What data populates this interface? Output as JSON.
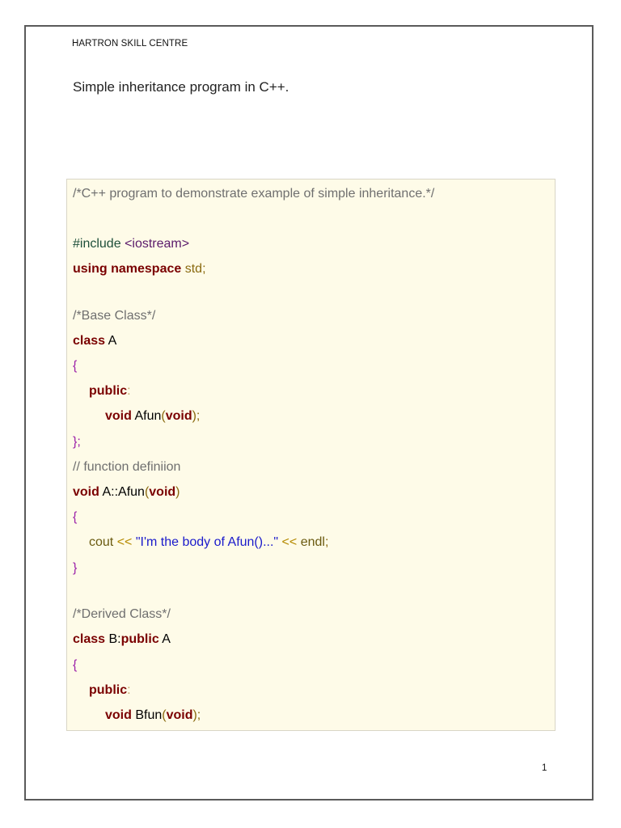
{
  "header": {
    "org": "HARTRON SKILL CENTRE"
  },
  "document": {
    "title": "Simple inheritance program in C++.",
    "page_number": "1"
  },
  "code": {
    "l1_comment": "/*C++ program to demonstrate example of simple inheritance.*/",
    "l2_directive": "#include",
    "l2_header": "<iostream>",
    "l3_kw": "using namespace",
    "l3_std": "std",
    "l3_semi": ";",
    "l4_comment": "/*Base Class*/",
    "l5_kw": "class",
    "l5_name": " A",
    "l6_brace": "{",
    "l7_kw": "public",
    "l7_colon": ":",
    "l8_kw": "void",
    "l8_name": " Afun",
    "l8_open": "(",
    "l8_param": "void",
    "l8_close": ");",
    "l9_close": "};",
    "l10_comment": "// function definiion",
    "l11_kw": "void",
    "l11_name": " A::Afun",
    "l11_open": "(",
    "l11_param": "void",
    "l11_close": ")",
    "l12_brace": "{",
    "l13_cout": "cout",
    "l13_op1": " << ",
    "l13_str": "\"I'm the body of Afun()...\"",
    "l13_op2": " << ",
    "l13_endl": "endl",
    "l13_semi": ";",
    "l14_brace": "}",
    "l15_comment": "/*Derived Class*/",
    "l16_kw": "class",
    "l16_name": " B:",
    "l16_kw2": "public",
    "l16_base": " A",
    "l17_brace": "{",
    "l18_kw": "public",
    "l18_colon": ":",
    "l19_kw": "void",
    "l19_name": " Bfun",
    "l19_open": "(",
    "l19_param": "void",
    "l19_close": ");"
  }
}
